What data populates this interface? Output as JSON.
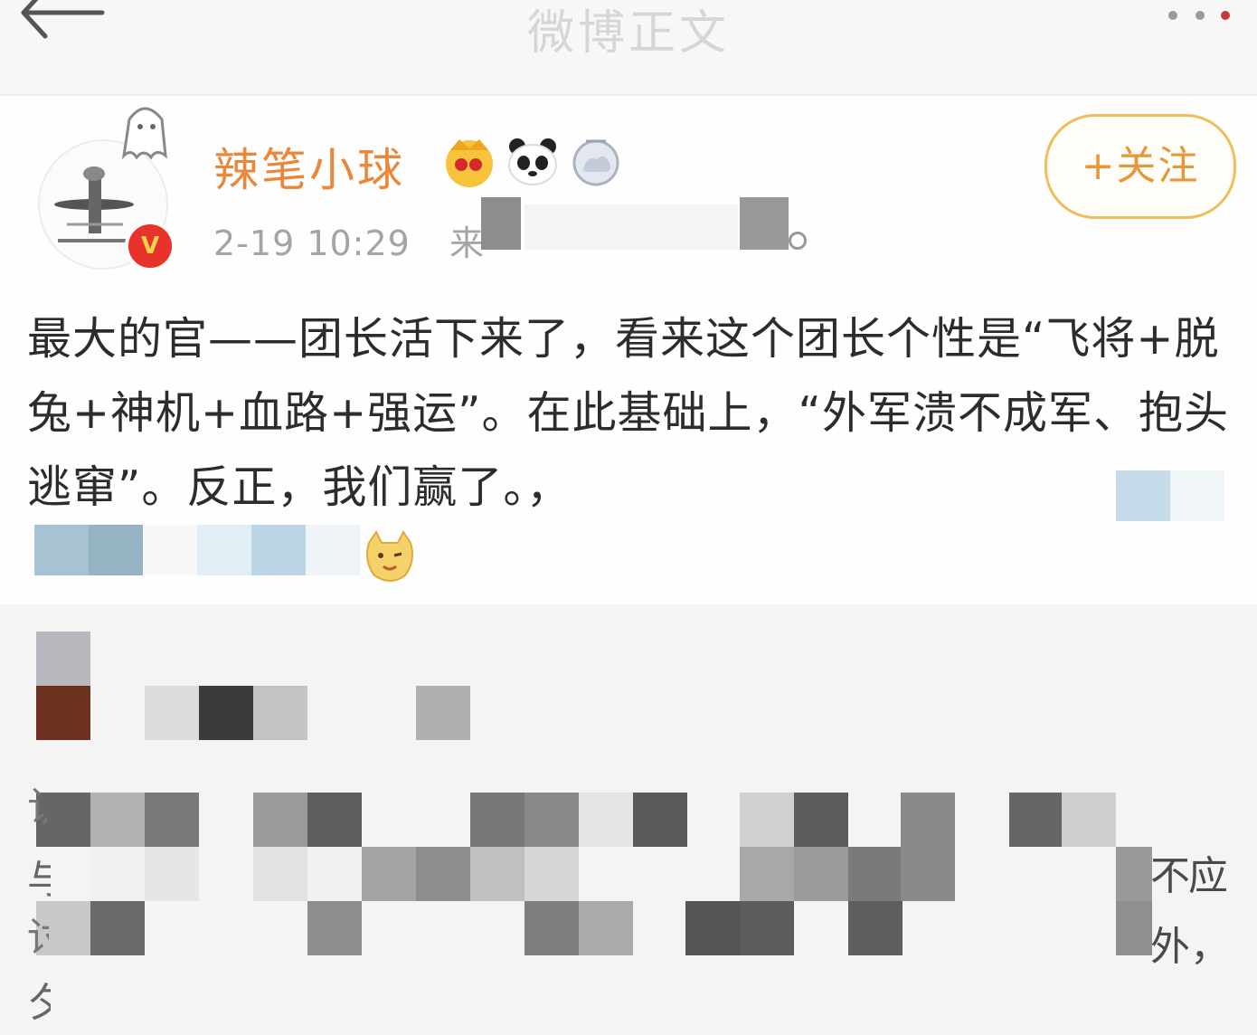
{
  "nav": {
    "title": "微博正文",
    "back_icon": "arrow-left-icon",
    "more_icon": "more-dots-icon"
  },
  "post": {
    "username": "辣笔小球",
    "timestamp": "2-19 10:29",
    "source_prefix": "来",
    "follow_label": "+关注",
    "verified_badge": "V",
    "text": "最大的官——团长活下来了，看来这个团长个性是“飞将+脱兔+神机+血路+强运”。在此基础上，“外军溃不成军、抱头逃窜”。反正，我们赢了。，",
    "badges": [
      "crown-badge-icon",
      "panda-badge-icon",
      "cloud-badge-icon"
    ],
    "emoji": "doge-emoji-icon",
    "username_color": "#e9873a",
    "accent_color": "#efbd5e",
    "verified_color": "#e8332a"
  },
  "comment": {
    "fragments": [
      "应",
      "不",
      "外，"
    ]
  }
}
